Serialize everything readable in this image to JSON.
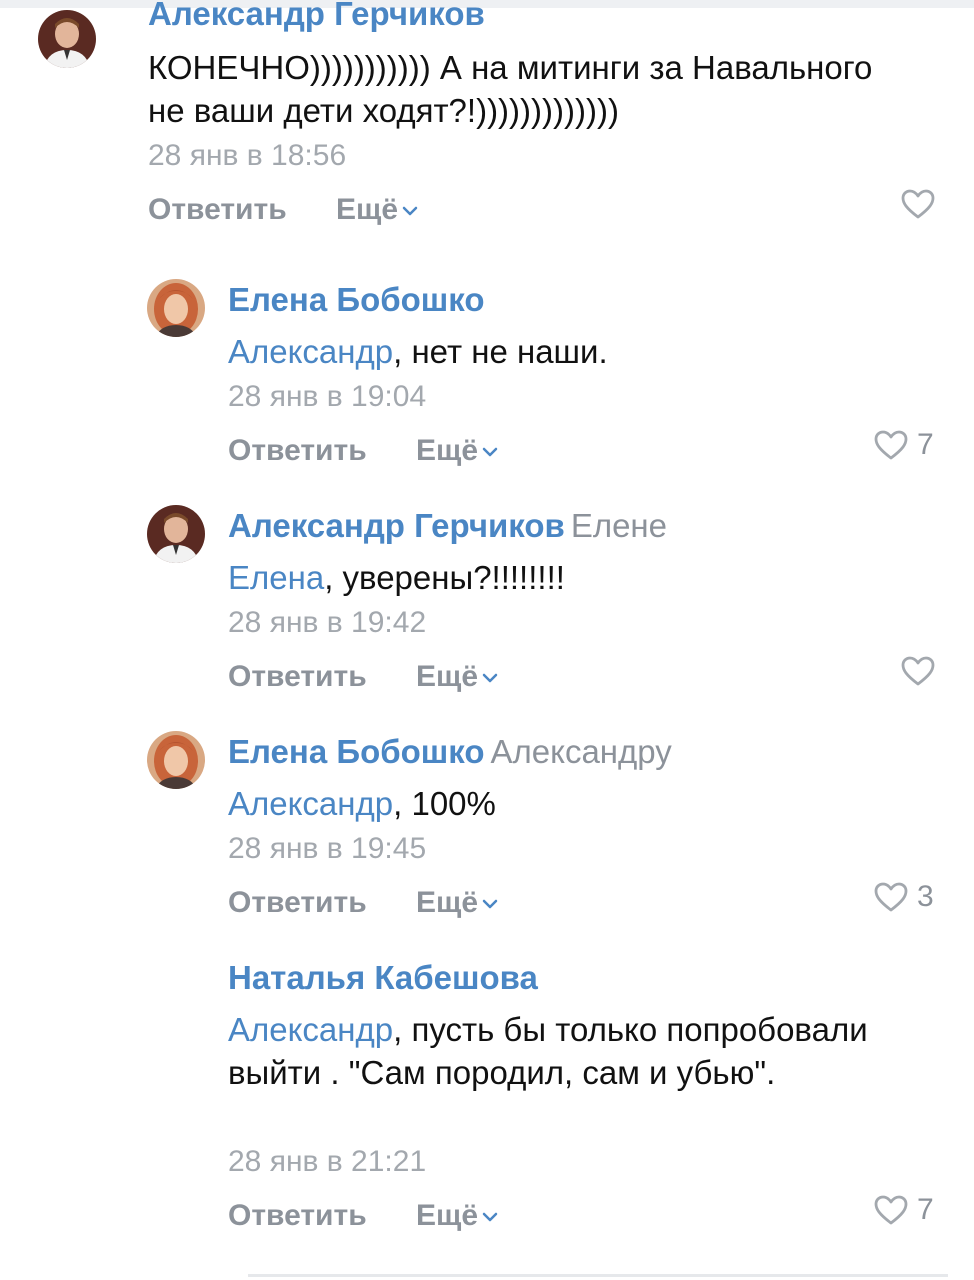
{
  "comments": [
    {
      "author": "Александр Герчиков",
      "reply_to": "",
      "mention": "",
      "text": "КОНЕЧНО))))))))))) А на митинги за Навального не ваши дети ходят?!)))))))))))))",
      "date": "28 янв в 18:56",
      "reply_label": "Ответить",
      "more_label": "Ещё",
      "likes": ""
    },
    {
      "author": "Елена Бобошко",
      "reply_to": "",
      "mention": "Александр",
      "text": ", нет не наши.",
      "date": "28 янв в 19:04",
      "reply_label": "Ответить",
      "more_label": "Ещё",
      "likes": "7"
    },
    {
      "author": "Александр Герчиков",
      "reply_to": "Елене",
      "mention": "Елена",
      "text": ", уверены?!!!!!!!!",
      "date": "28 янв в 19:42",
      "reply_label": "Ответить",
      "more_label": "Ещё",
      "likes": ""
    },
    {
      "author": "Елена Бобошко",
      "reply_to": "Александру",
      "mention": "Александр",
      "text": ", 100%",
      "date": "28 янв в 19:45",
      "reply_label": "Ответить",
      "more_label": "Ещё",
      "likes": "3"
    },
    {
      "author": "Наталья Кабешова",
      "reply_to": "",
      "mention": "Александр",
      "text": ", пусть бы только попробовали выйти . \"Сам породил, сам и убью\".",
      "date": "28 янв в 21:21",
      "reply_label": "Ответить",
      "more_label": "Ещё",
      "likes": "7"
    }
  ],
  "colors": {
    "link": "#4a86c4",
    "muted": "#8c929a",
    "date": "#a3a8ae"
  },
  "icons": {
    "like": "heart-outline-icon",
    "more": "chevron-down-icon"
  }
}
